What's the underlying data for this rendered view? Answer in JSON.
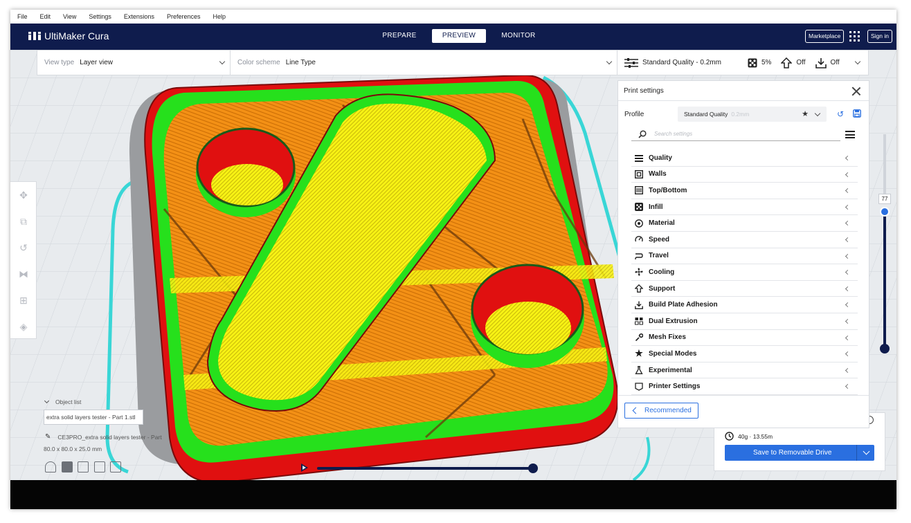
{
  "menu": [
    "File",
    "Edit",
    "View",
    "Settings",
    "Extensions",
    "Preferences",
    "Help"
  ],
  "app": {
    "name": "UltiMaker Cura"
  },
  "stages": [
    {
      "label": "PREPARE",
      "active": false
    },
    {
      "label": "PREVIEW",
      "active": true
    },
    {
      "label": "MONITOR",
      "active": false
    }
  ],
  "header_buttons": {
    "marketplace": "Marketplace",
    "sign_in": "Sign in"
  },
  "viewbar": {
    "view_type_label": "View type",
    "view_type_value": "Layer view",
    "color_scheme_label": "Color scheme",
    "color_scheme_value": "Line Type",
    "quality": "Standard Quality - 0.2mm",
    "infill": "5%",
    "support": "Off",
    "adhesion": "Off"
  },
  "print_settings": {
    "title": "Print settings",
    "profile_label": "Profile",
    "profile_value": "Standard Quality",
    "profile_sub": "0.2mm",
    "search_placeholder": "Search settings",
    "categories": [
      {
        "label": "Quality",
        "icon": "quality-icon"
      },
      {
        "label": "Walls",
        "icon": "walls-icon"
      },
      {
        "label": "Top/Bottom",
        "icon": "top-bottom-icon"
      },
      {
        "label": "Infill",
        "icon": "infill-icon"
      },
      {
        "label": "Material",
        "icon": "material-icon"
      },
      {
        "label": "Speed",
        "icon": "speed-icon"
      },
      {
        "label": "Travel",
        "icon": "travel-icon"
      },
      {
        "label": "Cooling",
        "icon": "cooling-icon"
      },
      {
        "label": "Support",
        "icon": "support-icon"
      },
      {
        "label": "Build Plate Adhesion",
        "icon": "adhesion-icon"
      },
      {
        "label": "Dual Extrusion",
        "icon": "dual-extrusion-icon"
      },
      {
        "label": "Mesh Fixes",
        "icon": "mesh-fixes-icon"
      },
      {
        "label": "Special Modes",
        "icon": "special-modes-icon"
      },
      {
        "label": "Experimental",
        "icon": "experimental-icon"
      },
      {
        "label": "Printer Settings",
        "icon": "printer-settings-icon"
      }
    ],
    "recommended_label": "Recommended"
  },
  "object_list": {
    "title": "Object list",
    "file": "extra solid layers tester - Part 1.stl",
    "job_name": "CE3PRO_extra solid layers tester - Part",
    "dimensions": "80.0 x 80.0 x 25.0 mm"
  },
  "layer": {
    "current": "77"
  },
  "output": {
    "estimate": "40g · 13.55m",
    "save_label": "Save to Removable Drive"
  },
  "colors": {
    "header": "#0f1c4d",
    "accent": "#2a6fe0",
    "wall_outer": "#e01010",
    "wall_inner": "#22e01a",
    "skin": "#f5f012",
    "infill": "#f08c0a"
  }
}
